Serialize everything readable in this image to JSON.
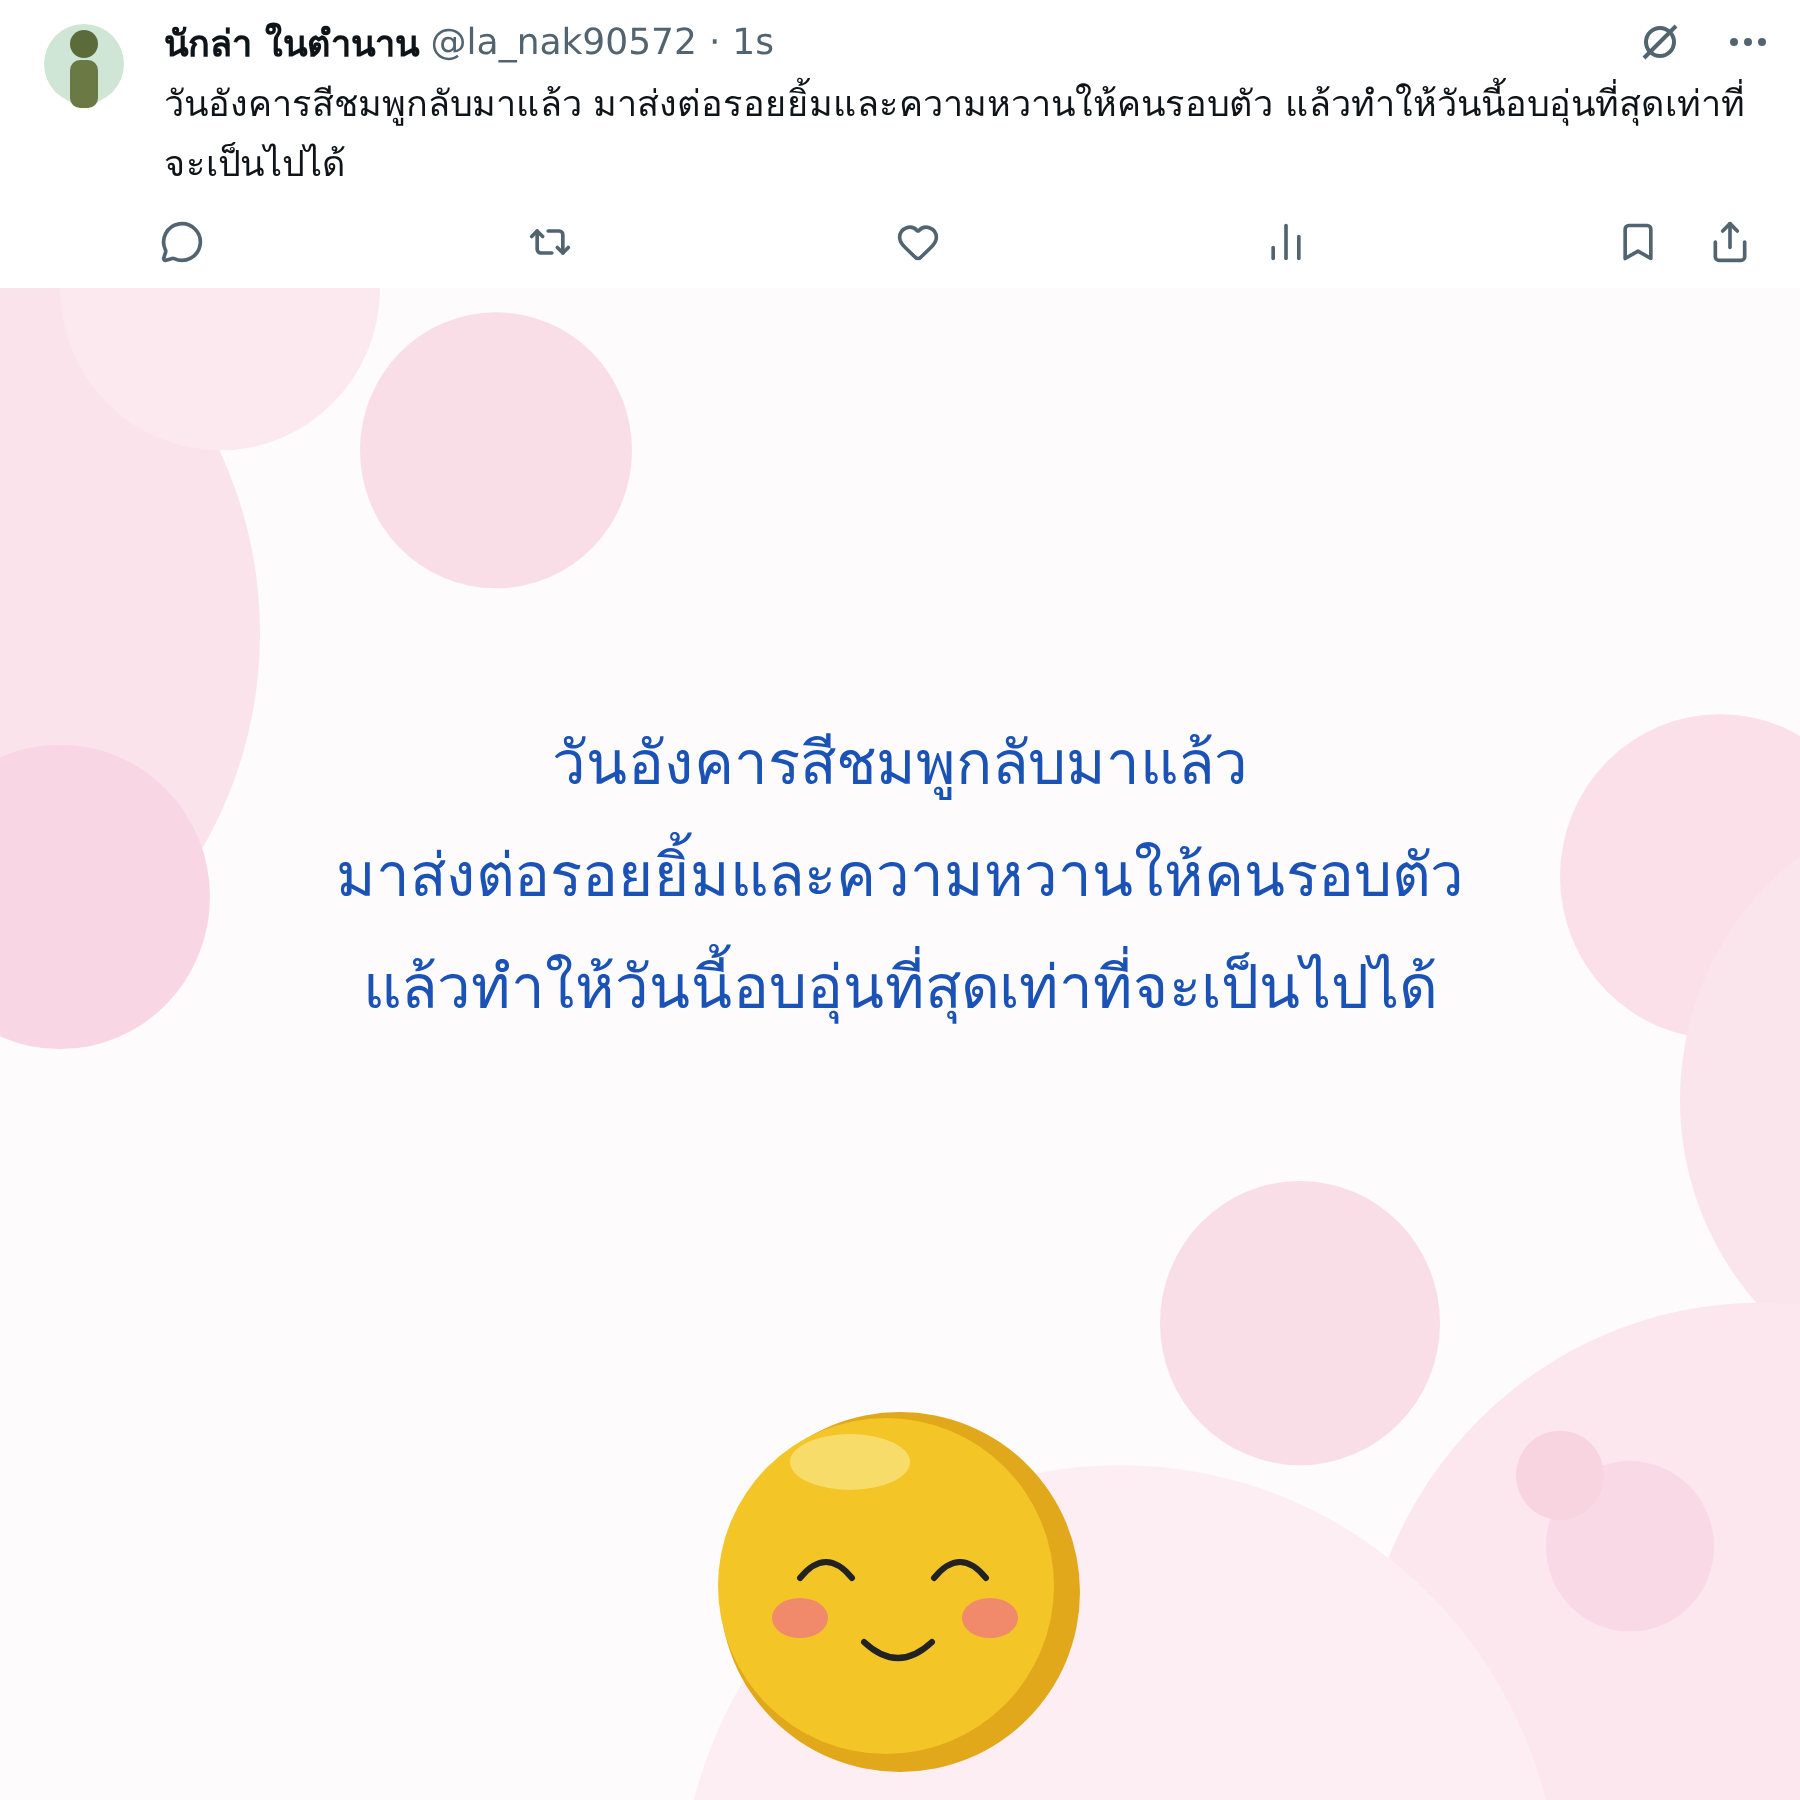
{
  "post": {
    "display_name": "นักล่า ในตำนาน",
    "handle": "@la_nak90572",
    "separator": "·",
    "time": "1s",
    "text": "วันอังคารสีชมพูกลับมาแล้ว มาส่งต่อรอยยิ้มและความหวานให้คนรอบตัว แล้วทำให้วันนี้อบอุ่นที่สุดเท่าที่จะเป็นไปได้"
  },
  "image": {
    "lines": [
      "วันอังคารสีชมพูกลับมาแล้ว",
      "มาส่งต่อรอยยิ้มและความหวานให้คนรอบตัว",
      "แล้วทำให้วันนี้อบอุ่นที่สุดเท่าที่จะเป็นไปได้"
    ]
  }
}
